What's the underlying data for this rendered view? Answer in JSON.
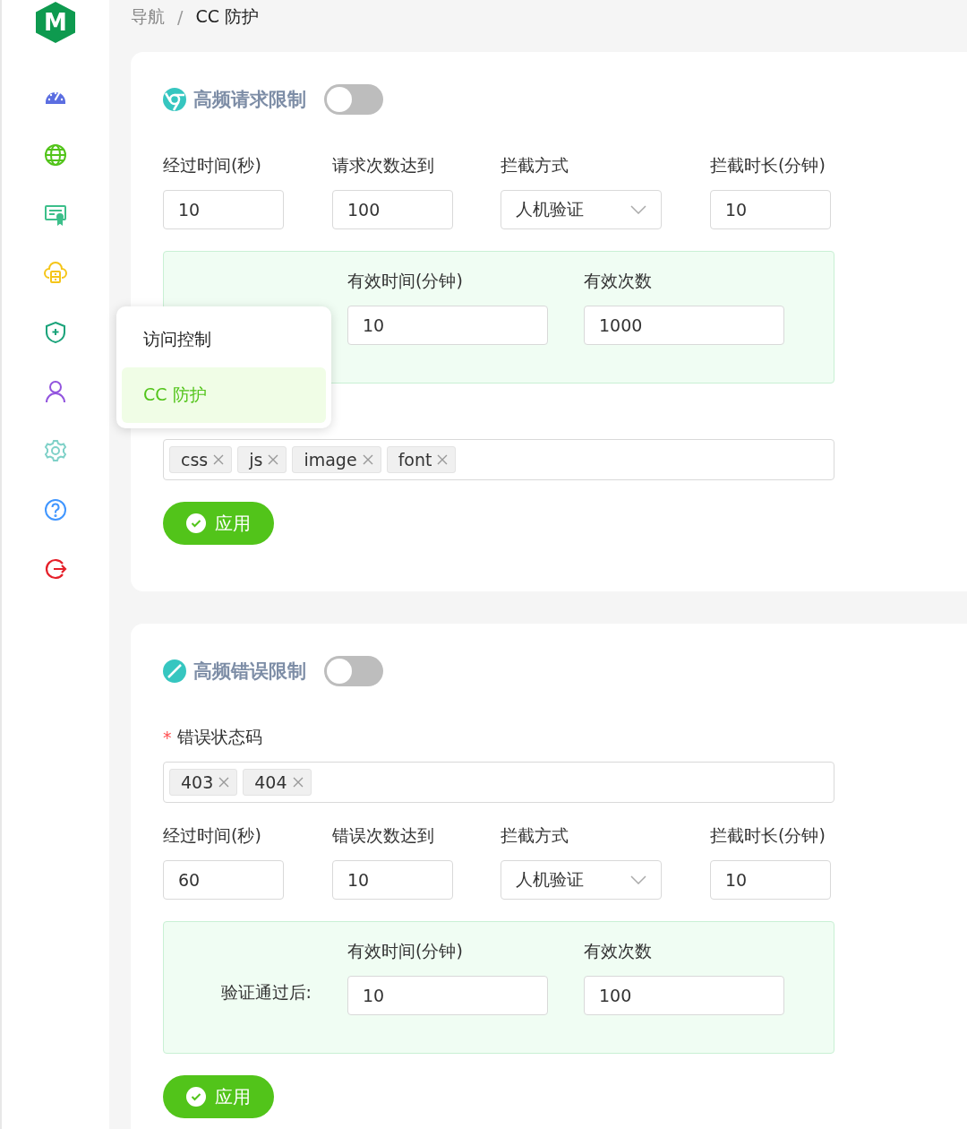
{
  "logo": {
    "text": "M"
  },
  "breadcrumb": {
    "items": [
      "导航",
      "CC 防护"
    ],
    "separator": "/"
  },
  "sections": [
    {
      "title": "高频请求限制",
      "on": false,
      "blocks": [
        {
          "kind": "fields",
          "fields": [
            {
              "kind": "input",
              "label": "经过时间(秒)",
              "value": "10"
            },
            {
              "kind": "input",
              "label": "请求次数达到",
              "value": "100"
            },
            {
              "kind": "select",
              "label": "拦截方式",
              "value": "人机验证"
            },
            {
              "kind": "input",
              "label": "拦截时长(分钟)",
              "value": "10"
            }
          ]
        },
        {
          "kind": "verify",
          "fields": [
            {
              "label": "有效时间(分钟)",
              "value": "10"
            },
            {
              "label": "有效次数",
              "value": "1000"
            }
          ]
        },
        {
          "kind": "tags",
          "tags": [
            "css",
            "js",
            "image",
            "font"
          ]
        }
      ],
      "apply": "应用"
    },
    {
      "title": "高频错误限制",
      "on": false,
      "blocks": [
        {
          "kind": "tags",
          "required_mark": "*",
          "label": "错误状态码",
          "tags": [
            "403",
            "404"
          ]
        },
        {
          "kind": "fields",
          "fields": [
            {
              "kind": "input",
              "label": "经过时间(秒)",
              "value": "60"
            },
            {
              "kind": "input",
              "label": "错误次数达到",
              "value": "10"
            },
            {
              "kind": "select",
              "label": "拦截方式",
              "value": "人机验证"
            },
            {
              "kind": "input",
              "label": "拦截时长(分钟)",
              "value": "10"
            }
          ]
        },
        {
          "kind": "verify",
          "label": "验证通过后:",
          "fields": [
            {
              "label": "有效时间(分钟)",
              "value": "10"
            },
            {
              "label": "有效次数",
              "value": "100"
            }
          ]
        }
      ],
      "apply": "应用"
    }
  ],
  "popup_menu": {
    "items": [
      {
        "label": "访问控制",
        "selected": false
      },
      {
        "label": "CC 防护",
        "selected": true
      }
    ]
  }
}
